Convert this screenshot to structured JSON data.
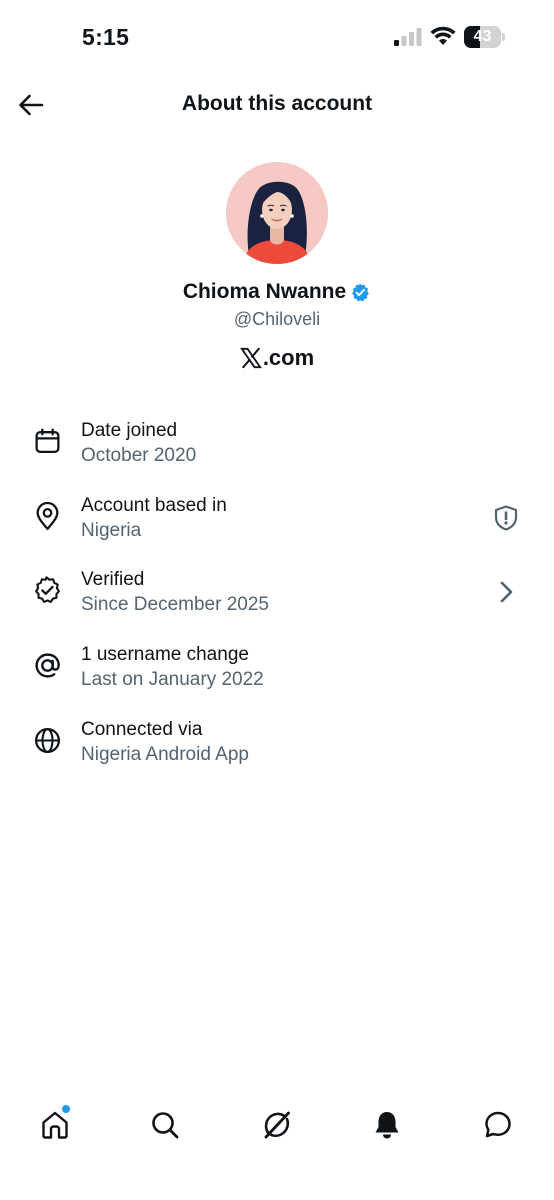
{
  "status_bar": {
    "time": "5:15",
    "battery_level": "43",
    "battery_fraction": 0.43
  },
  "header": {
    "title": "About this account"
  },
  "profile": {
    "display_name": "Chioma Nwanne",
    "handle": "@Chiloveli",
    "site": ".com",
    "verified": true
  },
  "info_items": [
    {
      "icon": "calendar-icon",
      "label": "Date joined",
      "value": "October 2020"
    },
    {
      "icon": "location-pin-icon",
      "label": "Account based in",
      "value": "Nigeria",
      "trailing_icon": "shield-alert-icon"
    },
    {
      "icon": "verified-badge-icon",
      "label": "Verified",
      "value": "Since December 2025",
      "trailing_icon": "chevron-right-icon"
    },
    {
      "icon": "at-sign-icon",
      "label": "1 username change",
      "value": "Last on January 2022"
    },
    {
      "icon": "globe-icon",
      "label": "Connected via",
      "value": "Nigeria Android App"
    }
  ],
  "bottom_nav": [
    {
      "icon": "home-icon",
      "has_notification_dot": true
    },
    {
      "icon": "search-icon"
    },
    {
      "icon": "grok-icon"
    },
    {
      "icon": "bell-icon"
    },
    {
      "icon": "messages-icon"
    }
  ],
  "colors": {
    "text_primary": "#0f1419",
    "text_secondary": "#536471",
    "accent_blue": "#1d9bf0",
    "avatar_bg": "#f7c9c4"
  }
}
